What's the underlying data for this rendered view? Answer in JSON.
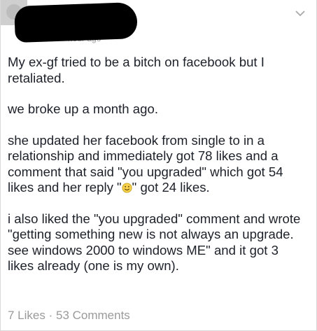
{
  "post": {
    "meta_text": "hour ago",
    "paragraphs": {
      "p1": "My ex-gf tried to be a bitch on facebook but I retaliated.",
      "p2": "we broke up a month ago.",
      "p3_before": "she updated her facebook from single to in a relationship and immediately got 78 likes and a comment that said \"you upgraded\" which got 54 likes and her reply \"",
      "p3_after": "\" got 24 likes.",
      "p4": "i also liked the \"you upgraded\" comment and wrote \"getting something new is not always an upgrade. see windows 2000 to windows ME\" and it got 3 likes already (one is my own)."
    },
    "footer": {
      "likes": "7 Likes",
      "separator": " · ",
      "comments": "53 Comments"
    },
    "icons": {
      "menu": "chevron-down-icon",
      "emoji": "smiley-emoji-icon",
      "avatar": "avatar-icon"
    }
  }
}
